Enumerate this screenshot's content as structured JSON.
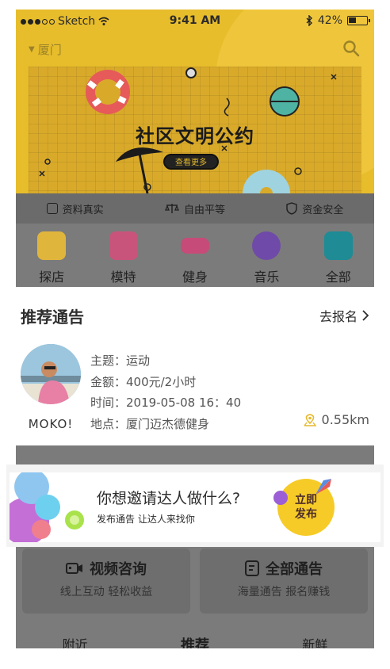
{
  "status_bar": {
    "carrier": "Sketch",
    "time": "9:41 AM",
    "battery": "42%",
    "battery_level": 0.42
  },
  "header": {
    "city": "厦门"
  },
  "banner": {
    "title": "社区文明公约",
    "button": "查看更多"
  },
  "features": [
    {
      "label": "资料真实",
      "icon": "id-card-icon"
    },
    {
      "label": "自由平等",
      "icon": "scale-icon"
    },
    {
      "label": "资金安全",
      "icon": "shield-icon"
    }
  ],
  "categories": [
    {
      "label": "探店",
      "icon": "store-icon",
      "color": "#e0b53c"
    },
    {
      "label": "模特",
      "icon": "dress-icon",
      "color": "#c9547b"
    },
    {
      "label": "健身",
      "icon": "dumbbell-icon",
      "color": "#c64b78"
    },
    {
      "label": "音乐",
      "icon": "music-icon",
      "color": "#6f4aa8"
    },
    {
      "label": "全部",
      "icon": "grid-icon",
      "color": "#1e8b95"
    }
  ],
  "notice": {
    "title": "推荐通告",
    "more": "去报名",
    "user": "MOKO!",
    "topic": "主题：运动",
    "amount": "金额：400元/2小时",
    "time": "时间：2019-05-08 16：40",
    "place": "地点：厦门迈杰德健身",
    "distance": "0.55km"
  },
  "promo": {
    "title": "你想邀请达人做什么?",
    "subtitle": "发布通告 让达人来找你",
    "badge_line1": "立即",
    "badge_line2": "发布"
  },
  "services": [
    {
      "title": "视频咨询",
      "subtitle": "线上互动 轻松收益",
      "icon": "video-icon"
    },
    {
      "title": "全部通告",
      "subtitle": "海量通告 报名赚钱",
      "icon": "notice-icon"
    }
  ],
  "tabs": [
    "附近",
    "推荐",
    "新鲜"
  ],
  "colors": {
    "accent": "#f6cb27",
    "banner": "#e7bd2c",
    "overlay": "#7b7b7b"
  }
}
